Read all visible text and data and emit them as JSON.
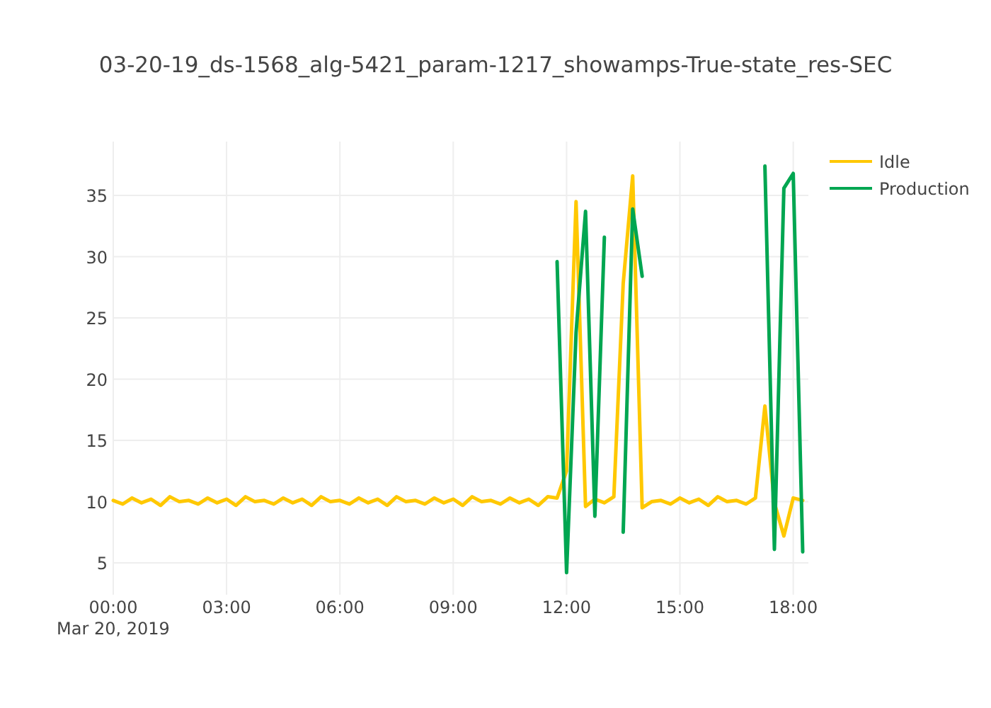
{
  "chart": {
    "date_label": "Mar 20, 2019",
    "chart_data": {
      "type": "line",
      "title": "03-20-19_ds-1568_alg-5421_param-1217_showamps-True-state_res-SEC",
      "x": [
        0,
        0.25,
        0.5,
        0.75,
        1,
        1.25,
        1.5,
        1.75,
        2,
        2.25,
        2.5,
        2.75,
        3,
        3.25,
        3.5,
        3.75,
        4,
        4.25,
        4.5,
        4.75,
        5,
        5.25,
        5.5,
        5.75,
        6,
        6.25,
        6.5,
        6.75,
        7,
        7.25,
        7.5,
        7.75,
        8,
        8.25,
        8.5,
        8.75,
        9,
        9.25,
        9.5,
        9.75,
        10,
        10.25,
        10.5,
        10.75,
        11,
        11.25,
        11.5,
        11.75,
        12,
        12.25,
        12.5,
        12.75,
        13,
        13.25,
        13.5,
        13.75,
        14,
        14.25,
        14.5,
        14.75,
        15,
        15.25,
        15.5,
        15.75,
        16,
        16.25,
        16.5,
        16.75,
        17,
        17.25,
        17.5,
        17.75,
        18,
        18.25
      ],
      "series": [
        {
          "name": "Idle",
          "color": "#ffc800",
          "values": [
            10.1,
            9.8,
            10.3,
            9.9,
            10.2,
            9.7,
            10.4,
            10.0,
            10.1,
            9.8,
            10.3,
            9.9,
            10.2,
            9.7,
            10.4,
            10.0,
            10.1,
            9.8,
            10.3,
            9.9,
            10.2,
            9.7,
            10.4,
            10.0,
            10.1,
            9.8,
            10.3,
            9.9,
            10.2,
            9.7,
            10.4,
            10.0,
            10.1,
            9.8,
            10.3,
            9.9,
            10.2,
            9.7,
            10.4,
            10.0,
            10.1,
            9.8,
            10.3,
            9.9,
            10.2,
            9.7,
            10.4,
            10.3,
            12.5,
            34.5,
            9.6,
            10.2,
            9.9,
            10.4,
            27.8,
            36.6,
            9.5,
            10.0,
            10.1,
            9.8,
            10.3,
            9.9,
            10.2,
            9.7,
            10.4,
            10.0,
            10.1,
            9.8,
            10.3,
            17.8,
            9.9,
            7.2,
            10.3,
            10.1
          ]
        },
        {
          "name": "Production",
          "color": "#00a651",
          "values": [
            null,
            null,
            null,
            null,
            null,
            null,
            null,
            null,
            null,
            null,
            null,
            null,
            null,
            null,
            null,
            null,
            null,
            null,
            null,
            null,
            null,
            null,
            null,
            null,
            null,
            null,
            null,
            null,
            null,
            null,
            null,
            null,
            null,
            null,
            null,
            null,
            null,
            null,
            null,
            null,
            null,
            null,
            null,
            null,
            null,
            null,
            null,
            29.6,
            4.2,
            23.8,
            33.7,
            8.8,
            31.6,
            null,
            7.5,
            33.9,
            28.4,
            null,
            null,
            null,
            null,
            null,
            null,
            null,
            null,
            null,
            null,
            null,
            null,
            37.4,
            6.1,
            35.6,
            36.8,
            5.9
          ]
        }
      ],
      "xlim": [
        0,
        18.4
      ],
      "ylim": [
        2.4,
        39.4
      ],
      "xticks": [
        {
          "value": 0,
          "label": "00:00"
        },
        {
          "value": 3,
          "label": "03:00"
        },
        {
          "value": 6,
          "label": "06:00"
        },
        {
          "value": 9,
          "label": "09:00"
        },
        {
          "value": 12,
          "label": "12:00"
        },
        {
          "value": 15,
          "label": "15:00"
        },
        {
          "value": 18,
          "label": "18:00"
        }
      ],
      "yticks": [
        5,
        10,
        15,
        20,
        25,
        30,
        35
      ],
      "grid": true,
      "legend": true
    }
  }
}
